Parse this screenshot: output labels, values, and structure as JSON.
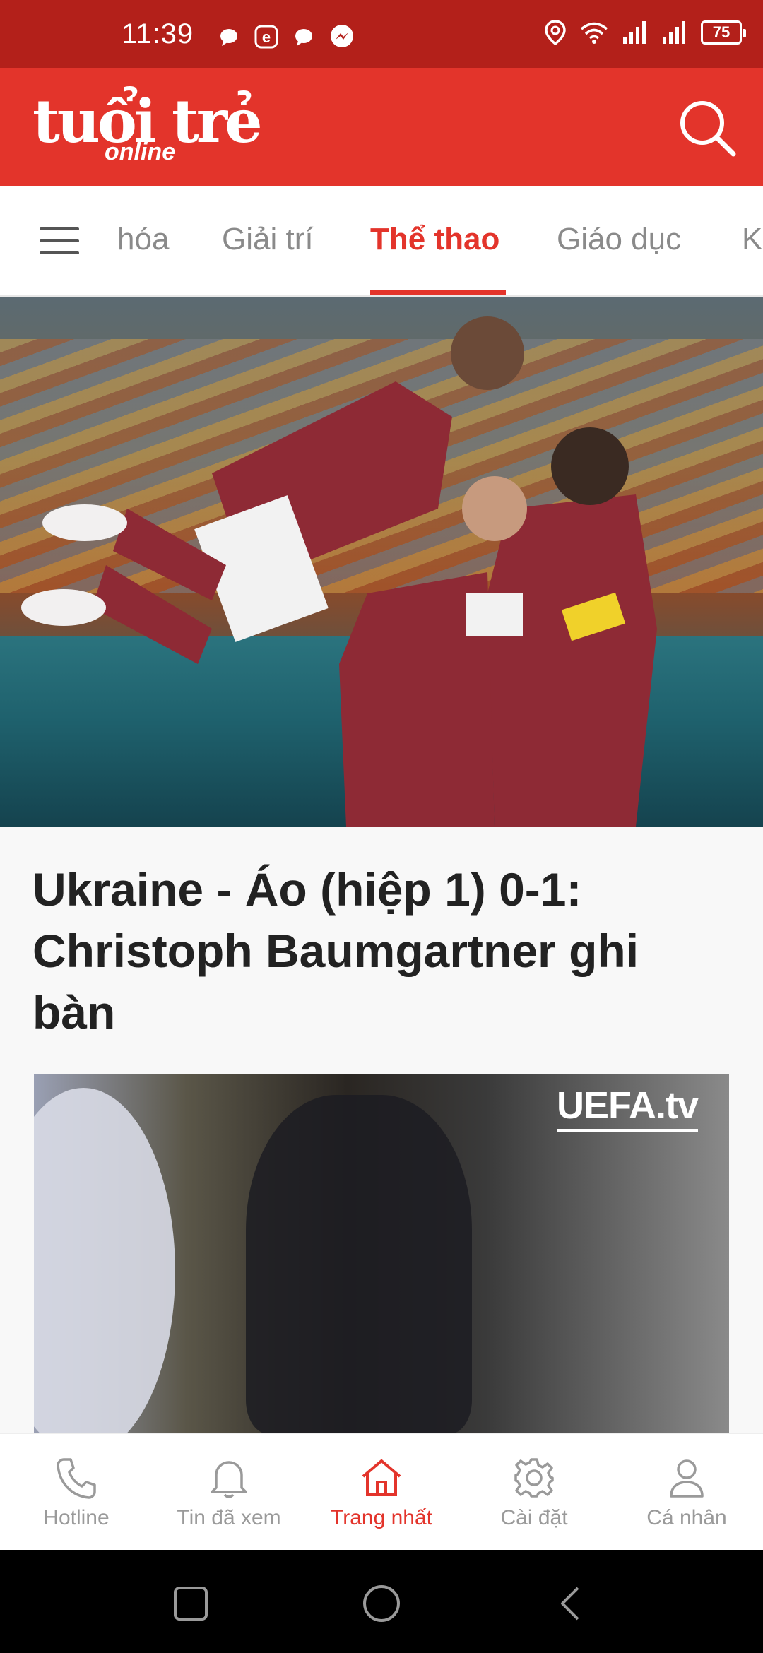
{
  "status_bar": {
    "time": "11:39",
    "battery": "75",
    "notification_icons": [
      "chat-icon",
      "e-icon",
      "chat-icon",
      "messenger-icon"
    ],
    "system_icons": [
      "location-icon",
      "wifi-icon",
      "signal-icon",
      "signal-icon",
      "battery-icon"
    ]
  },
  "header": {
    "logo_main": "tuổi trẻ",
    "logo_sub": "online",
    "search_icon": "search-icon"
  },
  "tabs": {
    "items": [
      {
        "label": "hóa"
      },
      {
        "label": "Giải trí"
      },
      {
        "label": "Thể thao",
        "active": true
      },
      {
        "label": "Giáo dục"
      },
      {
        "label": "K"
      }
    ]
  },
  "article": {
    "title": "Ukraine - Áo (hiệp 1) 0-1: Christoph Baumgartner ghi bàn",
    "video_watermark": "UEFA.tv"
  },
  "bottom_nav": {
    "items": [
      {
        "label": "Hotline",
        "icon": "phone-icon"
      },
      {
        "label": "Tin đã xem",
        "icon": "bell-icon"
      },
      {
        "label": "Trang nhất",
        "icon": "home-icon",
        "active": true
      },
      {
        "label": "Cài đặt",
        "icon": "gear-icon"
      },
      {
        "label": "Cá nhân",
        "icon": "user-icon"
      }
    ]
  },
  "colors": {
    "status_bar": "#b3201a",
    "brand_red": "#e3342b",
    "inactive_text": "#8a8a8a",
    "title_text": "#222222"
  }
}
